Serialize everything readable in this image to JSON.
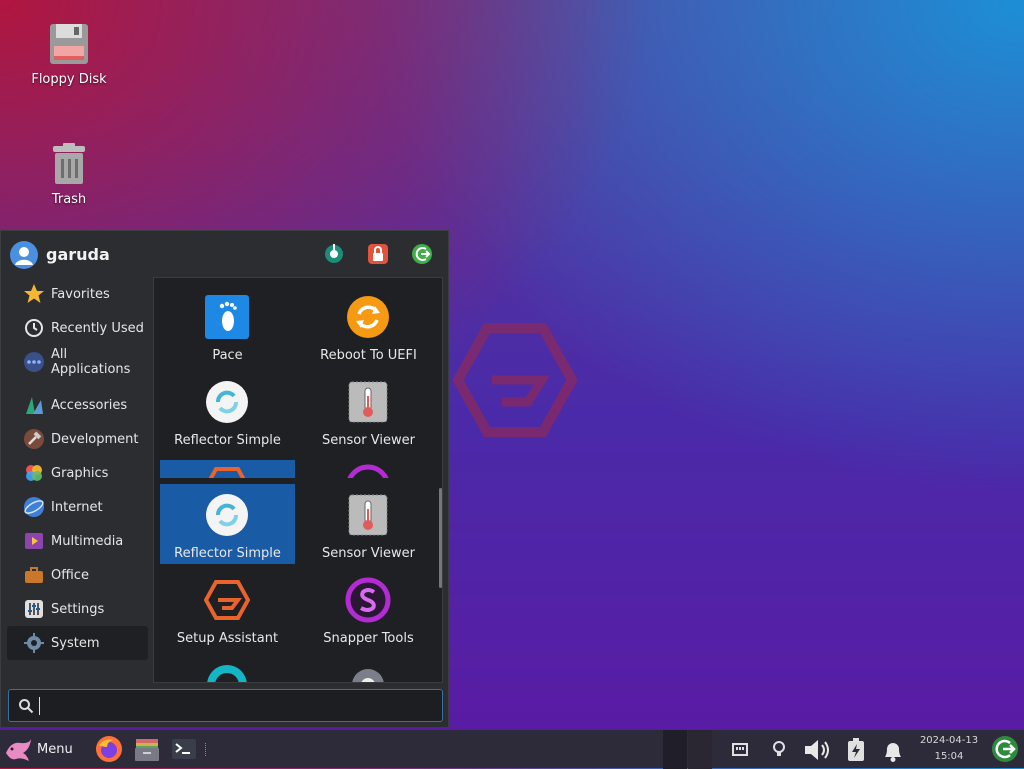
{
  "desktop": {
    "icons": [
      {
        "label": "Floppy Disk",
        "icon": "floppy-disk-icon"
      },
      {
        "label": "Trash",
        "icon": "trash-icon"
      }
    ]
  },
  "menu": {
    "username": "garuda",
    "header_buttons": [
      "settings-manager-icon",
      "lock-screen-icon",
      "logout-icon"
    ],
    "categories": [
      {
        "label": "Favorites",
        "icon": "star-icon"
      },
      {
        "label": "Recently Used",
        "icon": "clock-icon"
      },
      {
        "label": "All Applications",
        "icon": "apps-icon"
      },
      {
        "label": "Accessories",
        "icon": "accessories-icon"
      },
      {
        "label": "Development",
        "icon": "hammer-icon"
      },
      {
        "label": "Graphics",
        "icon": "graphics-icon"
      },
      {
        "label": "Internet",
        "icon": "internet-icon"
      },
      {
        "label": "Multimedia",
        "icon": "multimedia-icon"
      },
      {
        "label": "Office",
        "icon": "briefcase-icon"
      },
      {
        "label": "Settings",
        "icon": "settings-icon"
      },
      {
        "label": "System",
        "icon": "gear-icon"
      }
    ],
    "selected_category": "System",
    "apps": [
      {
        "label": "Pace",
        "icon": "footprint-icon"
      },
      {
        "label": "Reboot To UEFI",
        "icon": "reboot-icon"
      },
      {
        "label": "Reflector Simple",
        "icon": "reflector-icon"
      },
      {
        "label": "Sensor Viewer",
        "icon": "thermometer-icon"
      },
      {
        "label": "Reflector Simple",
        "icon": "reflector-icon"
      },
      {
        "label": "Sensor Viewer",
        "icon": "thermometer-icon"
      },
      {
        "label": "Setup Assistant",
        "icon": "garuda-logo-icon"
      },
      {
        "label": "Snapper Tools",
        "icon": "snapper-icon"
      }
    ],
    "search": {
      "value": "",
      "placeholder": ""
    }
  },
  "taskbar": {
    "menu_label": "Menu",
    "apps": [
      "firefox-icon",
      "file-manager-icon",
      "terminal-icon"
    ],
    "tray": [
      "network-icon",
      "lightbulb-icon",
      "volume-icon",
      "battery-icon",
      "notification-bell-icon",
      "logout-icon"
    ],
    "date": "2024-04-13",
    "time": "15:04"
  },
  "colors": {
    "accent": "#1a5ba6",
    "menu_bg": "#2b2d31",
    "panel_bg": "#2d2a3a"
  }
}
